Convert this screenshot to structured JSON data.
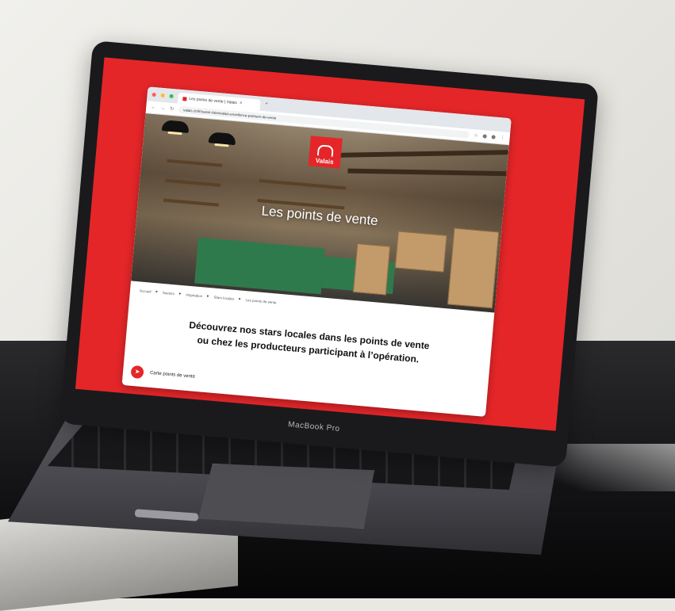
{
  "laptop": {
    "brand": "MacBook Pro"
  },
  "browser": {
    "tab_title": "Les points de vente | Valais",
    "tab_close": "×",
    "tab_new": "+",
    "url": "valais.ch/fr/savoir-faire/valais-excellence-partners-de-vente",
    "icons": [
      "back-icon",
      "forward-icon",
      "reload-icon",
      "star-icon",
      "extension-icon",
      "profile-icon",
      "menu-icon"
    ]
  },
  "page": {
    "logo_text": "Valais",
    "hero_title": "Les points de vente",
    "breadcrumb": [
      "Accueil",
      "Savoirs",
      "Inspiration",
      "Stars locales",
      "Les points de vente"
    ],
    "headline_line1": "Découvrez nos stars locales dans les points de vente",
    "headline_line2": "ou chez les producteurs participant à l’opération.",
    "map_link": "Carte points de vente"
  },
  "colors": {
    "screen_background": "#e42629",
    "brand_red": "#e42629"
  }
}
